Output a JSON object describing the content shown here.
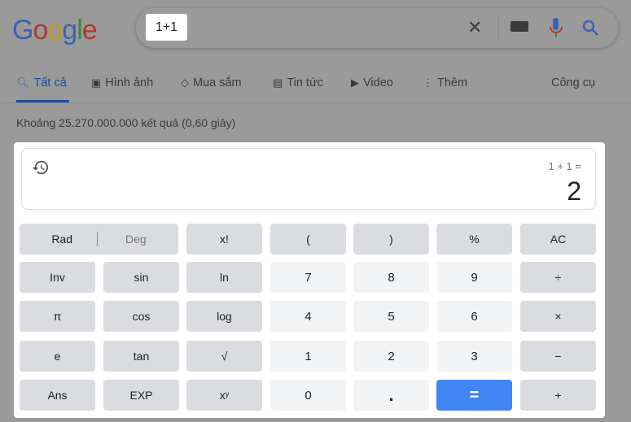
{
  "header": {
    "logo": "Google",
    "logo_colors": [
      "#3a63b5",
      "#b5352b",
      "#c49a14",
      "#3a63b5",
      "#2f8a45",
      "#b5352b"
    ],
    "search_query": "1+1",
    "icons": [
      "close-icon",
      "keyboard-icon",
      "microphone-icon",
      "search-icon"
    ]
  },
  "tabs": [
    {
      "label": "Tất cả",
      "icon": "search-icon",
      "active": true
    },
    {
      "label": "Hình ảnh",
      "icon": "image-icon"
    },
    {
      "label": "Mua sắm",
      "icon": "tag-icon"
    },
    {
      "label": "Tin tức",
      "icon": "news-icon"
    },
    {
      "label": "Video",
      "icon": "play-icon"
    },
    {
      "label": "Thêm",
      "icon": "more-vert-icon"
    }
  ],
  "tools_label": "Công cụ",
  "result_stats": "Khoảng 25.270.000.000 kết quả (0,60 giây)",
  "calculator": {
    "expression": "1 + 1 =",
    "result": "2",
    "rad": "Rad",
    "deg": "Deg",
    "buttons": [
      [
        "x!",
        "(",
        ")",
        "%",
        "AC"
      ],
      [
        "Inv",
        "sin",
        "ln",
        "7",
        "8",
        "9",
        "÷"
      ],
      [
        "π",
        "cos",
        "log",
        "4",
        "5",
        "6",
        "×"
      ],
      [
        "e",
        "tan",
        "√",
        "1",
        "2",
        "3",
        "−"
      ],
      [
        "Ans",
        "EXP",
        "xʸ",
        "0",
        ".",
        "=",
        "+"
      ]
    ],
    "equals_color": "#4285f4"
  }
}
